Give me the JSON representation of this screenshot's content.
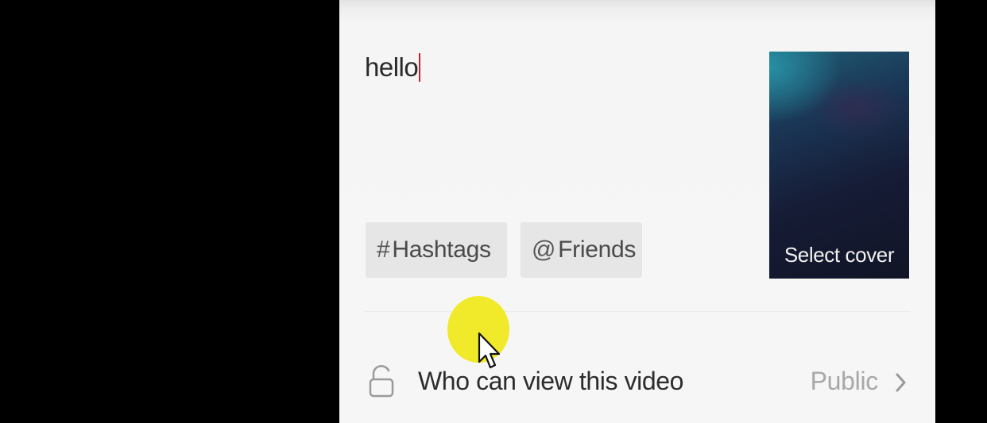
{
  "caption": {
    "value": "hello"
  },
  "chips": {
    "hashtags": {
      "symbol": "#",
      "label": "Hashtags"
    },
    "friends": {
      "symbol": "@",
      "label": "Friends"
    }
  },
  "cover": {
    "label": "Select cover"
  },
  "privacy": {
    "label": "Who can view this video",
    "value": "Public"
  },
  "icons": {
    "lock": "lock-icon",
    "chevron": "chevron-right-icon",
    "cursor": "mouse-pointer-icon"
  },
  "colors": {
    "caret": "#c8202f",
    "cursor_highlight": "#f1ea2a",
    "chip_background": "#e6e6e6",
    "muted_text": "#a8a8a8"
  }
}
